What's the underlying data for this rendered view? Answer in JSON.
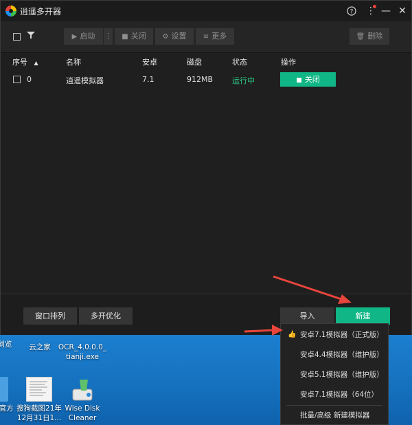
{
  "window": {
    "title": "逍遥多开器"
  },
  "titlebar": {
    "help": "?",
    "menu": "⋮",
    "minimize": "—",
    "close": "✕"
  },
  "toolbar": {
    "start": "启动",
    "more_dots": "⋮",
    "close": "关闭",
    "settings": "设置",
    "more": "更多",
    "delete": "删除"
  },
  "table": {
    "headers": {
      "index": "序号",
      "name": "名称",
      "android": "安卓",
      "disk": "磁盘",
      "status": "状态",
      "action": "操作"
    },
    "rows": [
      {
        "index": "0",
        "name": "逍遥模拟器",
        "android": "7.1",
        "disk": "912MB",
        "status": "运行中",
        "action": "关闭"
      }
    ]
  },
  "bottom": {
    "arrange": "窗口排列",
    "optimize": "多开优化",
    "import": "导入",
    "new": "新建"
  },
  "menu": {
    "items": [
      "安卓7.1模拟器（正式版）",
      "安卓4.4模拟器（维护版）",
      "安卓5.1模拟器（维护版）",
      "安卓7.1模拟器（64位）",
      "批量/高级 新建模拟器"
    ]
  },
  "desktop": {
    "icons": [
      {
        "label": "置浏览"
      },
      {
        "label": "云之家"
      },
      {
        "label": "OCR_4.0.0.0_\ntianji.exe"
      },
      {
        "label": "新官方"
      },
      {
        "label": "搜狗截图21年\n12月31日1..."
      },
      {
        "label": "Wise Disk\nCleaner"
      }
    ]
  },
  "colors": {
    "accent": "#10b685",
    "running": "#2ecc8a",
    "arrow": "#e8453c"
  }
}
